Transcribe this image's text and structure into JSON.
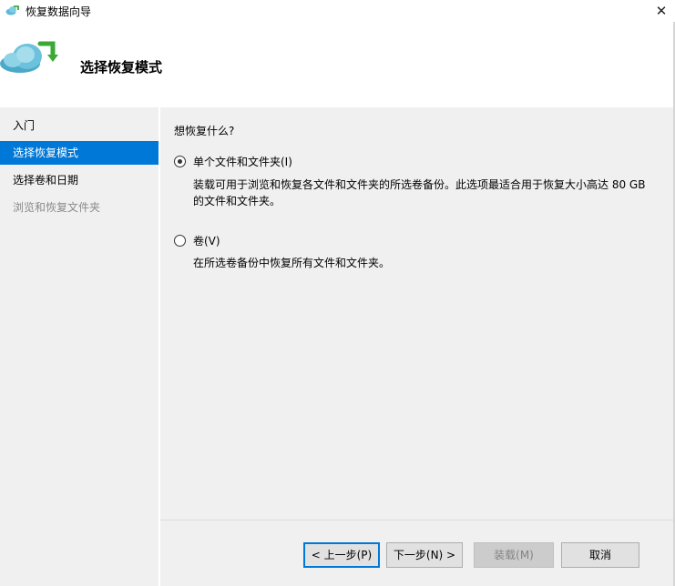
{
  "window": {
    "title": "恢复数据向导",
    "close_symbol": "✕"
  },
  "header": {
    "title": "选择恢复模式",
    "icon": "cloud-restore-icon"
  },
  "nav": {
    "items": [
      {
        "label": "入门",
        "state": "normal"
      },
      {
        "label": "选择恢复模式",
        "state": "selected"
      },
      {
        "label": "选择卷和日期",
        "state": "normal"
      },
      {
        "label": "浏览和恢复文件夹",
        "state": "disabled"
      }
    ]
  },
  "content": {
    "question": "想恢复什么?",
    "options": [
      {
        "label": "单个文件和文件夹(I)",
        "checked": true,
        "description_line1": "装载可用于浏览和恢复各文件和文件夹的所选卷备份。此选项最适合用于恢复大小高达 80 GB",
        "description_line2": "的文件和文件夹。"
      },
      {
        "label": "卷(V)",
        "checked": false,
        "description_line1": "在所选卷备份中恢复所有文件和文件夹。"
      }
    ]
  },
  "footer": {
    "back_label": "< 上一步(P)",
    "next_label": "下一步(N) >",
    "mount_label": "装载(M)",
    "cancel_label": "取消"
  },
  "colors": {
    "accent": "#0078d7",
    "panel": "#f0f0f0",
    "cloud": "#5bb9d6",
    "arrow": "#3aa935"
  }
}
